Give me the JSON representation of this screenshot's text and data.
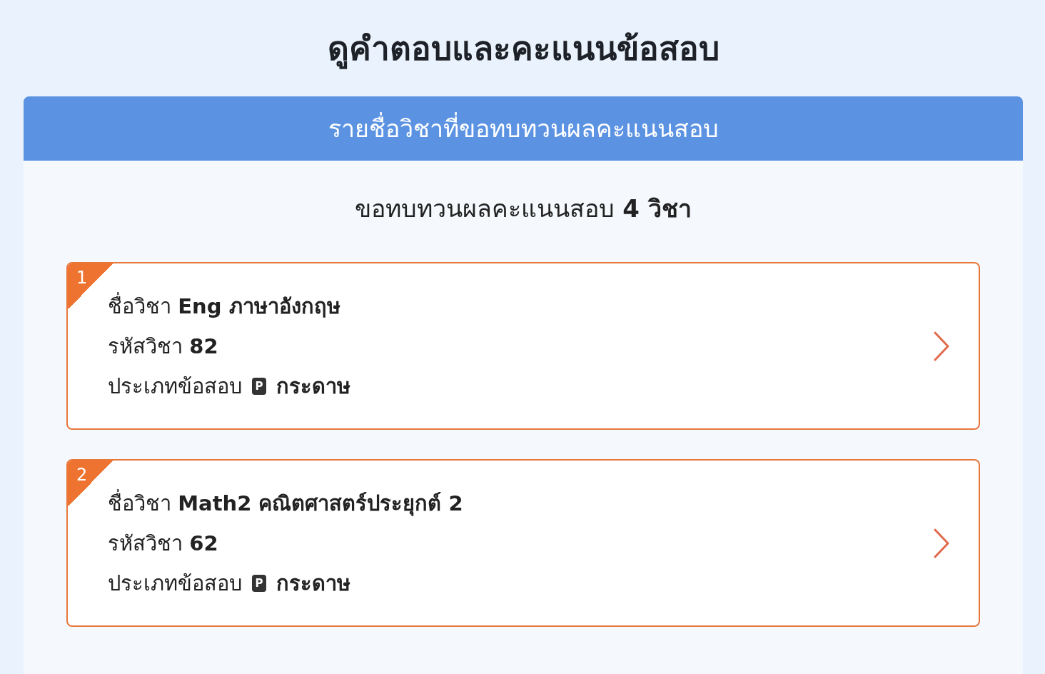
{
  "page_title": "ดูคำตอบและคะแนนข้อสอบ",
  "panel": {
    "header": "รายชื่อวิชาที่ขอทบทวนผลคะแนนสอบ",
    "summary": "ขอทบทวนผลคะแนนสอบ **4 วิชา**",
    "subjects": [
      {
        "number": "1",
        "name_line": "ชื่อวิชา **Eng ภาษาอังกฤษ**",
        "code_line": "รหัสวิชา **82**",
        "type_label": "ประเภทข้อสอบ",
        "type_icon": "P",
        "type": "กระดาษ"
      },
      {
        "number": "2",
        "name_line": "ชื่อวิชา **Math2 คณิตศาสตร์ประยุกต์ 2**",
        "code_line": "รหัสวิชา **62**",
        "type_label": "ประเภทข้อสอบ",
        "type_icon": "P",
        "type": "กระดาษ"
      }
    ]
  }
}
